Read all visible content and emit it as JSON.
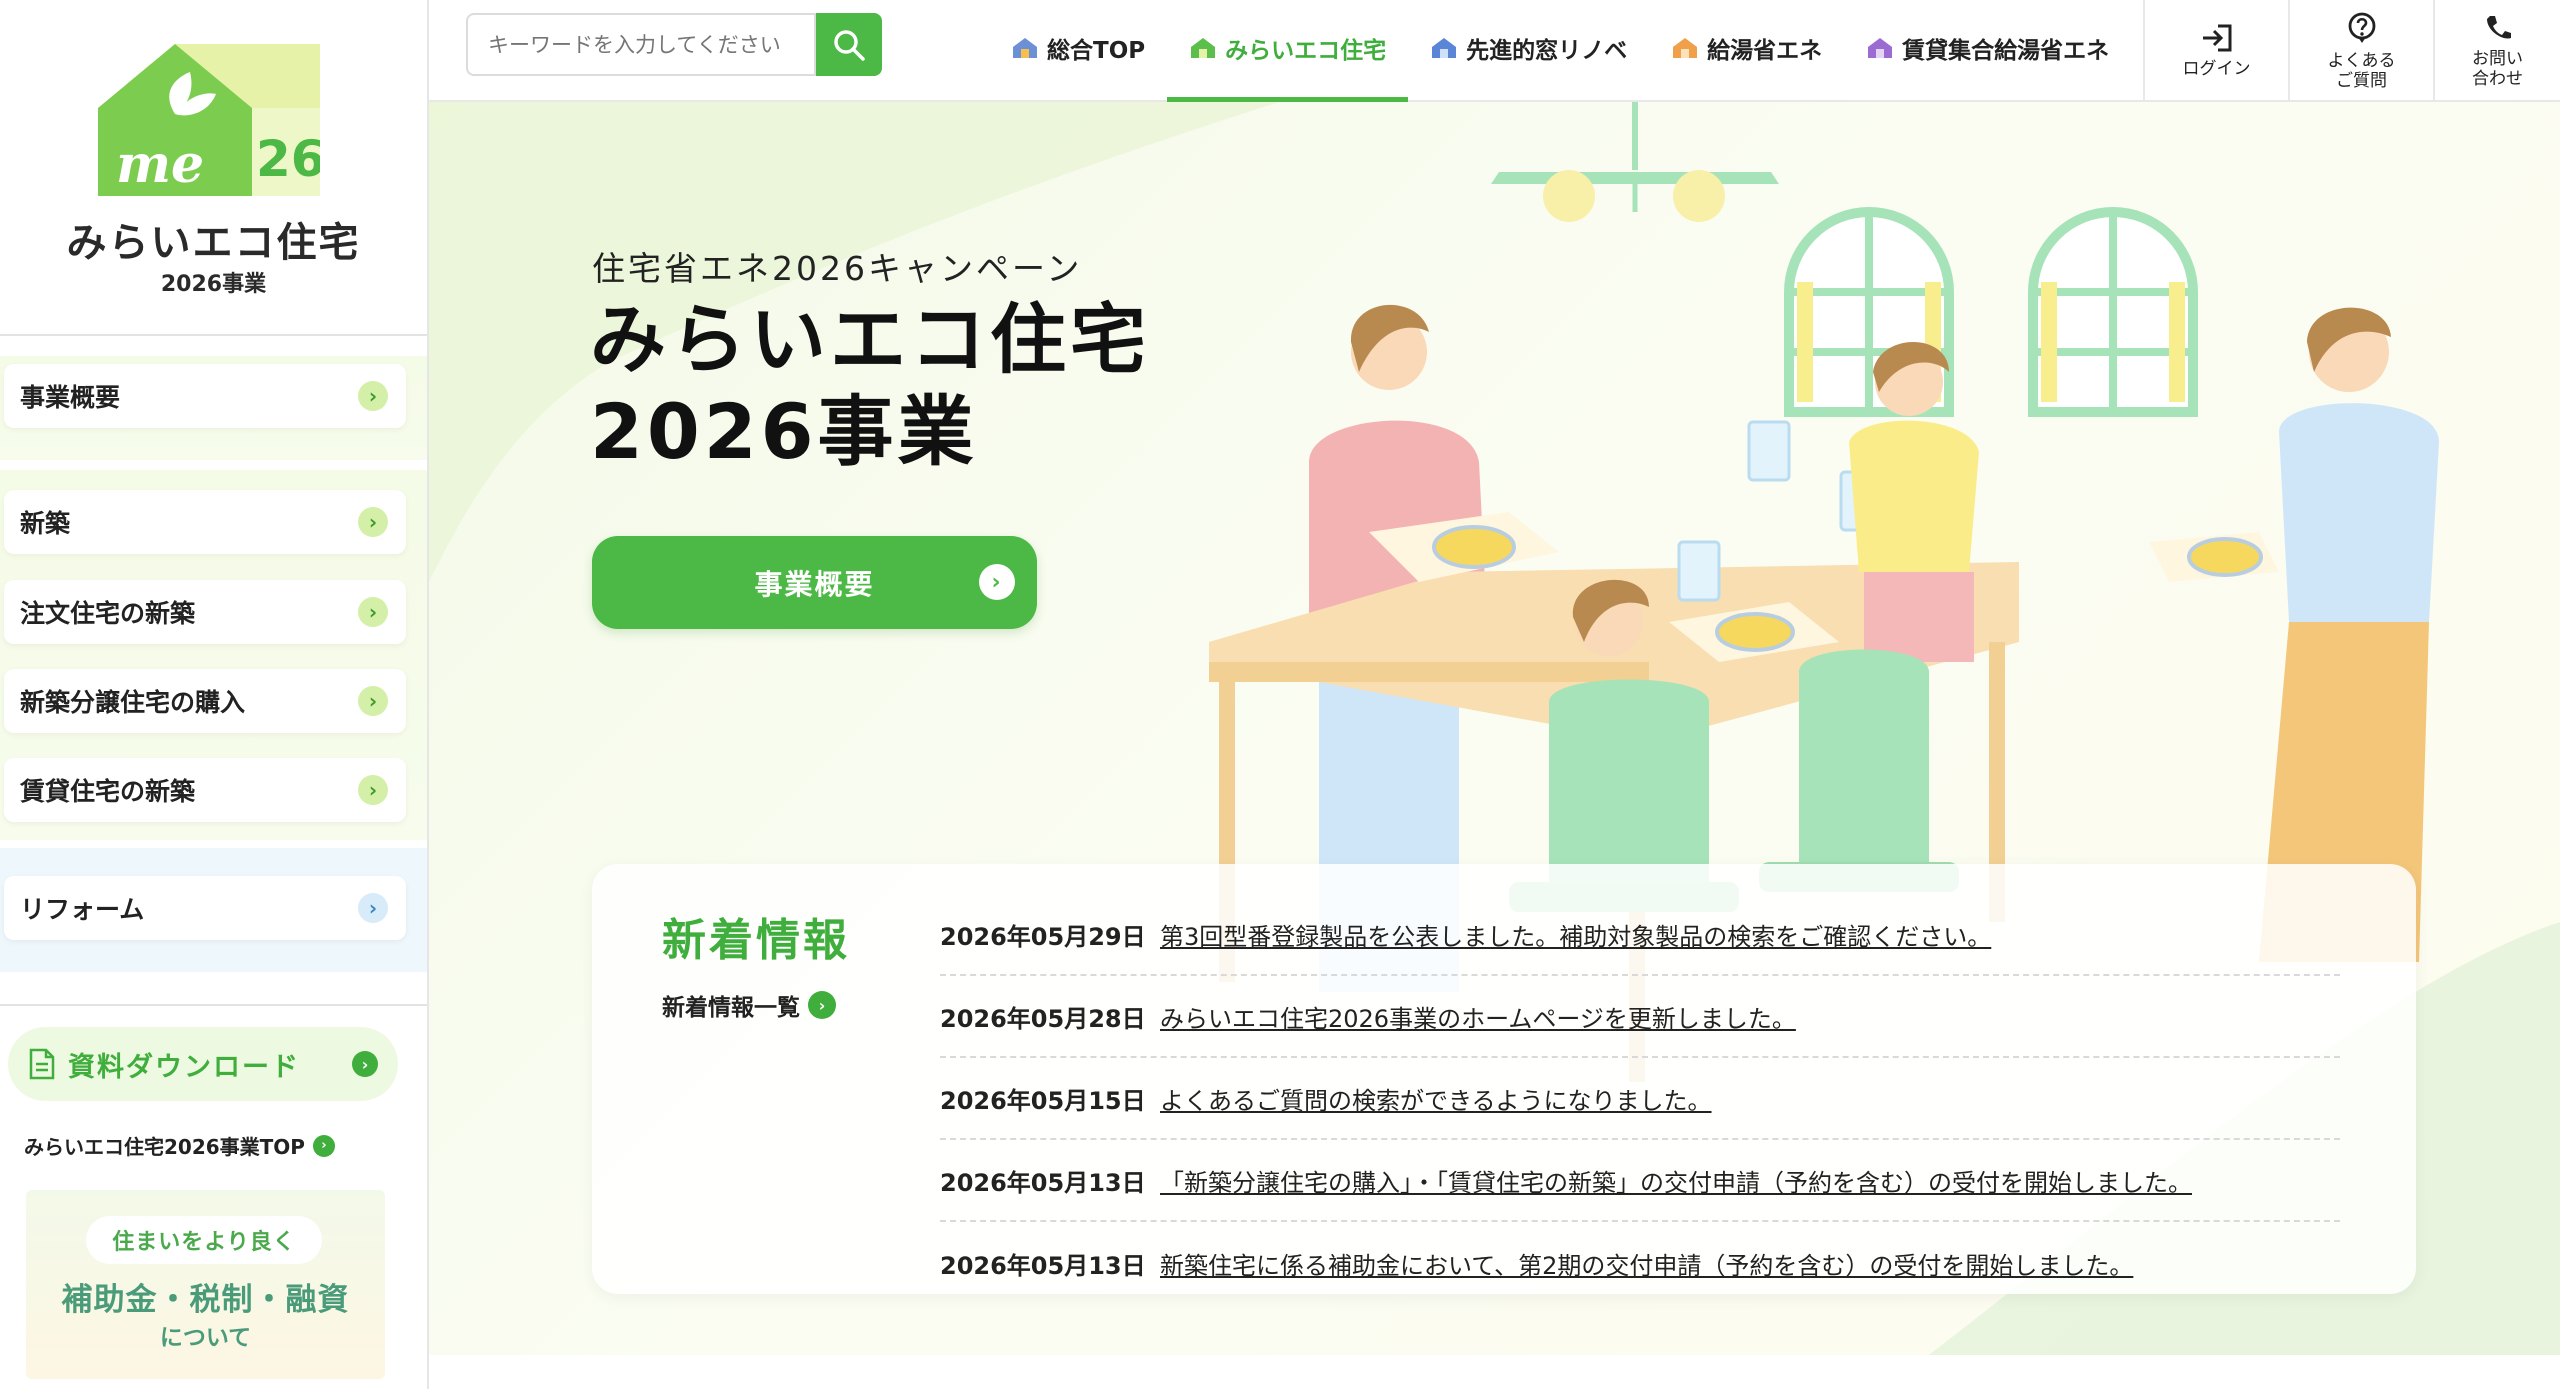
{
  "logo": {
    "badge_text": "me",
    "badge_number": "26",
    "title": "みらいエコ住宅",
    "subtitle": "2026事業"
  },
  "sidebar": {
    "items": [
      {
        "label": "事業概要"
      },
      {
        "label": "新築"
      },
      {
        "label": "注文住宅の新築"
      },
      {
        "label": "新築分譲住宅の購入"
      },
      {
        "label": "賃貸住宅の新築"
      },
      {
        "label": "リフォーム"
      }
    ],
    "download_label": "資料ダウンロード",
    "top_link": "みらいエコ住宅2026事業TOP",
    "banner": {
      "pill": "住まいをより良く",
      "big": "補助金・税制・融資",
      "small": "について"
    }
  },
  "search": {
    "placeholder": "キーワードを入力してください"
  },
  "nav": [
    {
      "label": "総合TOP",
      "icon_color": "#6c8fd6"
    },
    {
      "label": "みらいエコ住宅",
      "icon_color": "#5cbf4c"
    },
    {
      "label": "先進的窓リノベ",
      "icon_color": "#5b86d8"
    },
    {
      "label": "給湯省エネ",
      "icon_color": "#f0a04b"
    },
    {
      "label": "賃貸集合給湯省エネ",
      "icon_color": "#9a6bd0"
    }
  ],
  "util": {
    "login": "ログイン",
    "faq_1": "よくある",
    "faq_2": "ご質問",
    "contact_1": "お問い",
    "contact_2": "合わせ"
  },
  "hero": {
    "sub": "住宅省エネ2026キャンペーン",
    "title_1": "みらいエコ住宅",
    "title_2": "2026事業",
    "button": "事業概要"
  },
  "news": {
    "heading": "新着情報",
    "more": "新着情報一覧",
    "items": [
      {
        "date": "2026年05月29日",
        "text": "第3回型番登録製品を公表しました。補助対象製品の検索をご確認ください。"
      },
      {
        "date": "2026年05月28日",
        "text": "みらいエコ住宅2026事業のホームページを更新しました。"
      },
      {
        "date": "2026年05月15日",
        "text": "よくあるご質問の検索ができるようになりました。"
      },
      {
        "date": "2026年05月13日",
        "text": "「新築分譲住宅の購入」・「賃貸住宅の新築」の交付申請（予約を含む）の受付を開始しました。"
      },
      {
        "date": "2026年05月13日",
        "text": "新築住宅に係る補助金において、第2期の交付申請（予約を含む）の受付を開始しました。"
      }
    ]
  },
  "colors": {
    "brand_green": "#4cb845",
    "accent_text_green": "#3fae3c",
    "sidebar_blue": "#3b88c0"
  }
}
